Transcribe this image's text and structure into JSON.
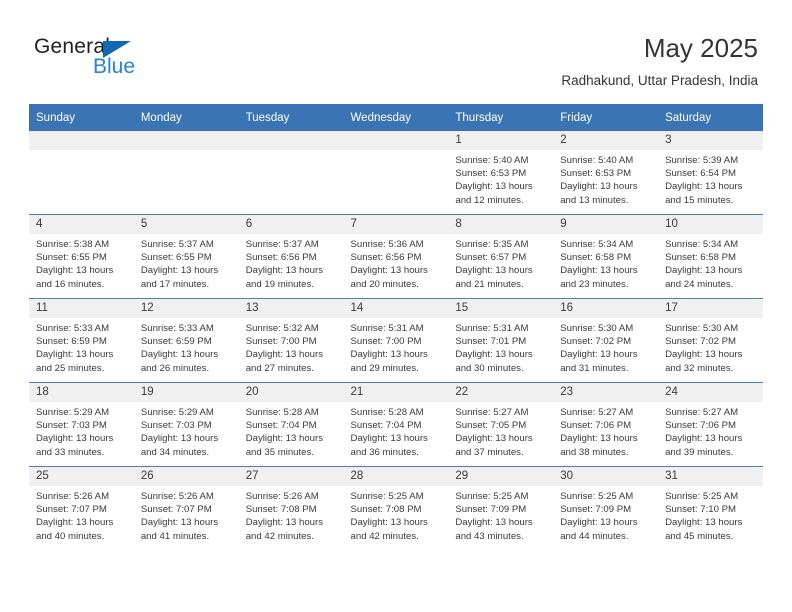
{
  "brand": {
    "name_part1": "General",
    "name_part2": "Blue",
    "triangle_color": "#1268b3",
    "blue_color": "#2585d3"
  },
  "header": {
    "title": "May 2025",
    "subtitle": "Radhakund, Uttar Pradesh, India",
    "header_bg": "#3a74b4"
  },
  "weekdays": [
    "Sunday",
    "Monday",
    "Tuesday",
    "Wednesday",
    "Thursday",
    "Friday",
    "Saturday"
  ],
  "labels": {
    "sunrise": "Sunrise:",
    "sunset": "Sunset:",
    "daylight": "Daylight:"
  },
  "weeks": [
    [
      {
        "day": "",
        "sunrise": "",
        "sunset": "",
        "daylight_1": "",
        "daylight_2": "",
        "empty": true
      },
      {
        "day": "",
        "sunrise": "",
        "sunset": "",
        "daylight_1": "",
        "daylight_2": "",
        "empty": true
      },
      {
        "day": "",
        "sunrise": "",
        "sunset": "",
        "daylight_1": "",
        "daylight_2": "",
        "empty": true
      },
      {
        "day": "",
        "sunrise": "",
        "sunset": "",
        "daylight_1": "",
        "daylight_2": "",
        "empty": true
      },
      {
        "day": "1",
        "sunrise": "Sunrise: 5:40 AM",
        "sunset": "Sunset: 6:53 PM",
        "daylight_1": "Daylight: 13 hours",
        "daylight_2": "and 12 minutes.",
        "empty": false
      },
      {
        "day": "2",
        "sunrise": "Sunrise: 5:40 AM",
        "sunset": "Sunset: 6:53 PM",
        "daylight_1": "Daylight: 13 hours",
        "daylight_2": "and 13 minutes.",
        "empty": false
      },
      {
        "day": "3",
        "sunrise": "Sunrise: 5:39 AM",
        "sunset": "Sunset: 6:54 PM",
        "daylight_1": "Daylight: 13 hours",
        "daylight_2": "and 15 minutes.",
        "empty": false
      }
    ],
    [
      {
        "day": "4",
        "sunrise": "Sunrise: 5:38 AM",
        "sunset": "Sunset: 6:55 PM",
        "daylight_1": "Daylight: 13 hours",
        "daylight_2": "and 16 minutes.",
        "empty": false
      },
      {
        "day": "5",
        "sunrise": "Sunrise: 5:37 AM",
        "sunset": "Sunset: 6:55 PM",
        "daylight_1": "Daylight: 13 hours",
        "daylight_2": "and 17 minutes.",
        "empty": false
      },
      {
        "day": "6",
        "sunrise": "Sunrise: 5:37 AM",
        "sunset": "Sunset: 6:56 PM",
        "daylight_1": "Daylight: 13 hours",
        "daylight_2": "and 19 minutes.",
        "empty": false
      },
      {
        "day": "7",
        "sunrise": "Sunrise: 5:36 AM",
        "sunset": "Sunset: 6:56 PM",
        "daylight_1": "Daylight: 13 hours",
        "daylight_2": "and 20 minutes.",
        "empty": false
      },
      {
        "day": "8",
        "sunrise": "Sunrise: 5:35 AM",
        "sunset": "Sunset: 6:57 PM",
        "daylight_1": "Daylight: 13 hours",
        "daylight_2": "and 21 minutes.",
        "empty": false
      },
      {
        "day": "9",
        "sunrise": "Sunrise: 5:34 AM",
        "sunset": "Sunset: 6:58 PM",
        "daylight_1": "Daylight: 13 hours",
        "daylight_2": "and 23 minutes.",
        "empty": false
      },
      {
        "day": "10",
        "sunrise": "Sunrise: 5:34 AM",
        "sunset": "Sunset: 6:58 PM",
        "daylight_1": "Daylight: 13 hours",
        "daylight_2": "and 24 minutes.",
        "empty": false
      }
    ],
    [
      {
        "day": "11",
        "sunrise": "Sunrise: 5:33 AM",
        "sunset": "Sunset: 6:59 PM",
        "daylight_1": "Daylight: 13 hours",
        "daylight_2": "and 25 minutes.",
        "empty": false
      },
      {
        "day": "12",
        "sunrise": "Sunrise: 5:33 AM",
        "sunset": "Sunset: 6:59 PM",
        "daylight_1": "Daylight: 13 hours",
        "daylight_2": "and 26 minutes.",
        "empty": false
      },
      {
        "day": "13",
        "sunrise": "Sunrise: 5:32 AM",
        "sunset": "Sunset: 7:00 PM",
        "daylight_1": "Daylight: 13 hours",
        "daylight_2": "and 27 minutes.",
        "empty": false
      },
      {
        "day": "14",
        "sunrise": "Sunrise: 5:31 AM",
        "sunset": "Sunset: 7:00 PM",
        "daylight_1": "Daylight: 13 hours",
        "daylight_2": "and 29 minutes.",
        "empty": false
      },
      {
        "day": "15",
        "sunrise": "Sunrise: 5:31 AM",
        "sunset": "Sunset: 7:01 PM",
        "daylight_1": "Daylight: 13 hours",
        "daylight_2": "and 30 minutes.",
        "empty": false
      },
      {
        "day": "16",
        "sunrise": "Sunrise: 5:30 AM",
        "sunset": "Sunset: 7:02 PM",
        "daylight_1": "Daylight: 13 hours",
        "daylight_2": "and 31 minutes.",
        "empty": false
      },
      {
        "day": "17",
        "sunrise": "Sunrise: 5:30 AM",
        "sunset": "Sunset: 7:02 PM",
        "daylight_1": "Daylight: 13 hours",
        "daylight_2": "and 32 minutes.",
        "empty": false
      }
    ],
    [
      {
        "day": "18",
        "sunrise": "Sunrise: 5:29 AM",
        "sunset": "Sunset: 7:03 PM",
        "daylight_1": "Daylight: 13 hours",
        "daylight_2": "and 33 minutes.",
        "empty": false
      },
      {
        "day": "19",
        "sunrise": "Sunrise: 5:29 AM",
        "sunset": "Sunset: 7:03 PM",
        "daylight_1": "Daylight: 13 hours",
        "daylight_2": "and 34 minutes.",
        "empty": false
      },
      {
        "day": "20",
        "sunrise": "Sunrise: 5:28 AM",
        "sunset": "Sunset: 7:04 PM",
        "daylight_1": "Daylight: 13 hours",
        "daylight_2": "and 35 minutes.",
        "empty": false
      },
      {
        "day": "21",
        "sunrise": "Sunrise: 5:28 AM",
        "sunset": "Sunset: 7:04 PM",
        "daylight_1": "Daylight: 13 hours",
        "daylight_2": "and 36 minutes.",
        "empty": false
      },
      {
        "day": "22",
        "sunrise": "Sunrise: 5:27 AM",
        "sunset": "Sunset: 7:05 PM",
        "daylight_1": "Daylight: 13 hours",
        "daylight_2": "and 37 minutes.",
        "empty": false
      },
      {
        "day": "23",
        "sunrise": "Sunrise: 5:27 AM",
        "sunset": "Sunset: 7:06 PM",
        "daylight_1": "Daylight: 13 hours",
        "daylight_2": "and 38 minutes.",
        "empty": false
      },
      {
        "day": "24",
        "sunrise": "Sunrise: 5:27 AM",
        "sunset": "Sunset: 7:06 PM",
        "daylight_1": "Daylight: 13 hours",
        "daylight_2": "and 39 minutes.",
        "empty": false
      }
    ],
    [
      {
        "day": "25",
        "sunrise": "Sunrise: 5:26 AM",
        "sunset": "Sunset: 7:07 PM",
        "daylight_1": "Daylight: 13 hours",
        "daylight_2": "and 40 minutes.",
        "empty": false
      },
      {
        "day": "26",
        "sunrise": "Sunrise: 5:26 AM",
        "sunset": "Sunset: 7:07 PM",
        "daylight_1": "Daylight: 13 hours",
        "daylight_2": "and 41 minutes.",
        "empty": false
      },
      {
        "day": "27",
        "sunrise": "Sunrise: 5:26 AM",
        "sunset": "Sunset: 7:08 PM",
        "daylight_1": "Daylight: 13 hours",
        "daylight_2": "and 42 minutes.",
        "empty": false
      },
      {
        "day": "28",
        "sunrise": "Sunrise: 5:25 AM",
        "sunset": "Sunset: 7:08 PM",
        "daylight_1": "Daylight: 13 hours",
        "daylight_2": "and 42 minutes.",
        "empty": false
      },
      {
        "day": "29",
        "sunrise": "Sunrise: 5:25 AM",
        "sunset": "Sunset: 7:09 PM",
        "daylight_1": "Daylight: 13 hours",
        "daylight_2": "and 43 minutes.",
        "empty": false
      },
      {
        "day": "30",
        "sunrise": "Sunrise: 5:25 AM",
        "sunset": "Sunset: 7:09 PM",
        "daylight_1": "Daylight: 13 hours",
        "daylight_2": "and 44 minutes.",
        "empty": false
      },
      {
        "day": "31",
        "sunrise": "Sunrise: 5:25 AM",
        "sunset": "Sunset: 7:10 PM",
        "daylight_1": "Daylight: 13 hours",
        "daylight_2": "and 45 minutes.",
        "empty": false
      }
    ]
  ]
}
